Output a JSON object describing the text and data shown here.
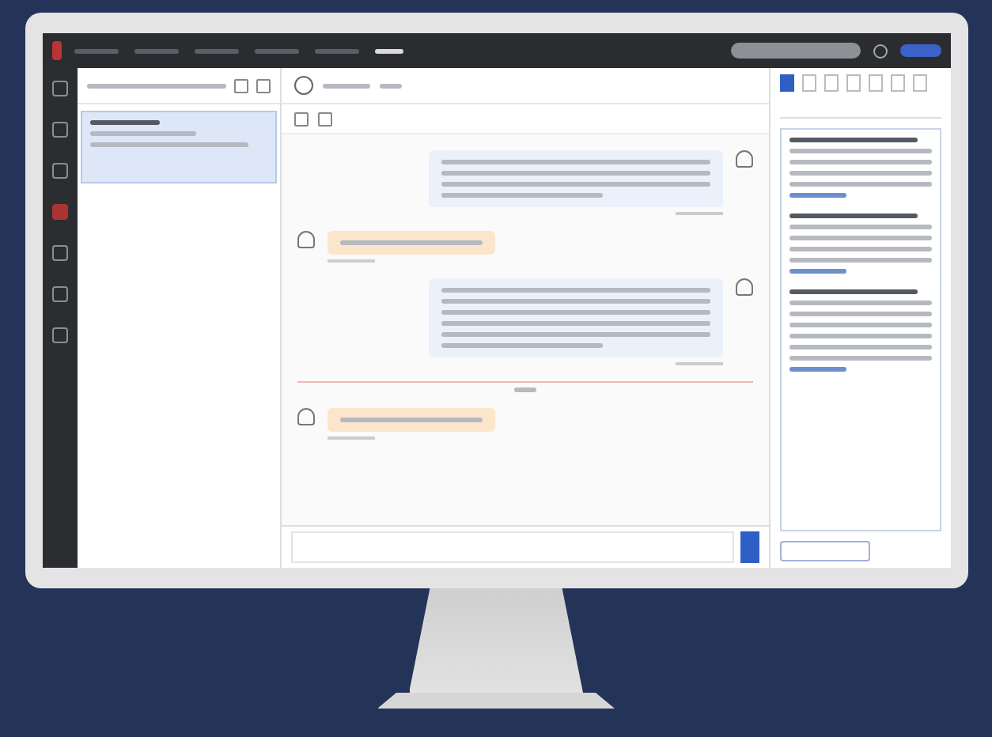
{
  "top_nav": {
    "items": [
      {
        "selected": false
      },
      {
        "selected": false
      },
      {
        "selected": false
      },
      {
        "selected": false
      },
      {
        "selected": false
      },
      {
        "selected": true
      }
    ]
  },
  "rail": {
    "items": [
      {
        "selected": false
      },
      {
        "selected": false
      },
      {
        "selected": false
      },
      {
        "selected": true
      },
      {
        "selected": false
      },
      {
        "selected": false
      },
      {
        "selected": false
      }
    ]
  },
  "conversations": [
    {
      "selected": true
    }
  ],
  "messages": [
    {
      "kind": "agent"
    },
    {
      "kind": "customer"
    },
    {
      "kind": "answer"
    },
    {
      "kind": "divider"
    },
    {
      "kind": "customer"
    }
  ],
  "panel_tabs": [
    {
      "selected": true
    },
    {
      "selected": false
    },
    {
      "selected": false
    },
    {
      "selected": false
    },
    {
      "selected": false
    },
    {
      "selected": false
    },
    {
      "selected": false
    }
  ],
  "articles": [
    {
      "kind": "brief"
    },
    {
      "kind": "brief"
    },
    {
      "kind": "detailed"
    }
  ]
}
